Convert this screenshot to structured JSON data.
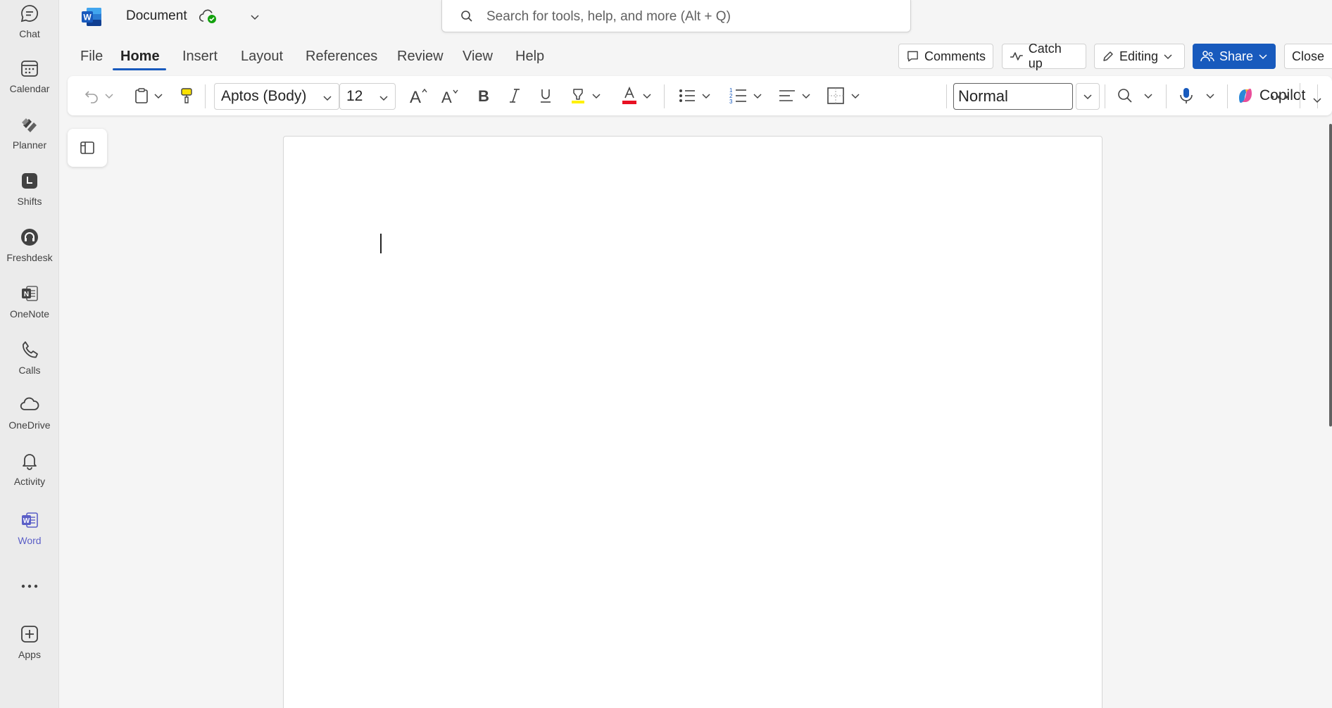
{
  "rail": {
    "items": [
      {
        "label": "Chat",
        "icon": "chat-icon"
      },
      {
        "label": "Calendar",
        "icon": "calendar-icon"
      },
      {
        "label": "Planner",
        "icon": "planner-icon"
      },
      {
        "label": "Shifts",
        "icon": "shifts-icon"
      },
      {
        "label": "Freshdesk",
        "icon": "freshdesk-icon"
      },
      {
        "label": "OneNote",
        "icon": "onenote-icon"
      },
      {
        "label": "Calls",
        "icon": "phone-icon"
      },
      {
        "label": "OneDrive",
        "icon": "cloud-icon"
      },
      {
        "label": "Activity",
        "icon": "bell-icon"
      },
      {
        "label": "Word",
        "icon": "word-icon",
        "active": true
      }
    ],
    "more_label": "...",
    "apps_label": "Apps",
    "active_color": "#5b5fc7"
  },
  "titlebar": {
    "doc_title": "Document",
    "save_status_icon": "cloud-check-icon",
    "search_placeholder": "Search for tools, help, and more (Alt + Q)"
  },
  "tabs": [
    "File",
    "Home",
    "Insert",
    "Layout",
    "References",
    "Review",
    "View",
    "Help"
  ],
  "active_tab": "Home",
  "header_buttons": {
    "comments": "Comments",
    "catch_up": "Catch up",
    "editing": "Editing",
    "share": "Share",
    "close": "Close"
  },
  "ribbon": {
    "font_name": "Aptos (Body)",
    "font_size": "12",
    "style": "Normal",
    "copilot": "Copilot"
  },
  "colors": {
    "accent": "#185abd",
    "font_color_bar": "#e81123",
    "highlight_bar": "#fff100",
    "word_brand": "#185abd"
  }
}
